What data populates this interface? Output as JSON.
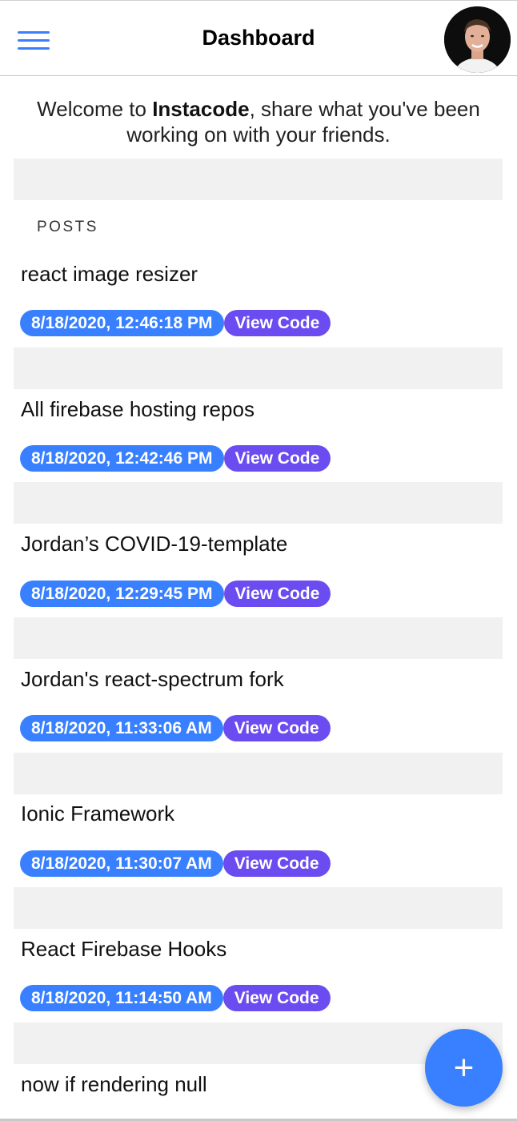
{
  "header": {
    "title": "Dashboard",
    "menu_icon": "hamburger-menu-icon",
    "avatar_icon": "user-avatar-photo"
  },
  "welcome": {
    "prefix": "Welcome to ",
    "brand": "Instacode",
    "suffix": ", share what you've been working on with your friends."
  },
  "posts_label": "POSTS",
  "posts": [
    {
      "title": "react image resizer",
      "date": "8/18/2020, 12:46:18 PM",
      "action": "View Code"
    },
    {
      "title": "All firebase hosting repos",
      "date": "8/18/2020, 12:42:46 PM",
      "action": "View Code"
    },
    {
      "title": "Jordan’s COVID-19-template",
      "date": "8/18/2020, 12:29:45 PM",
      "action": "View Code"
    },
    {
      "title": "Jordan's react-spectrum fork",
      "date": "8/18/2020, 11:33:06 AM",
      "action": "View Code"
    },
    {
      "title": "Ionic Framework",
      "date": "8/18/2020, 11:30:07 AM",
      "action": "View Code"
    },
    {
      "title": "React Firebase Hooks",
      "date": "8/18/2020, 11:14:50 AM",
      "action": "View Code"
    },
    {
      "title": "now if rendering null"
    }
  ],
  "fab": {
    "label": "+",
    "icon": "plus-icon"
  },
  "colors": {
    "primary": "#3880ff",
    "secondary": "#6a4cf0",
    "spacer": "#f1f1f1"
  }
}
